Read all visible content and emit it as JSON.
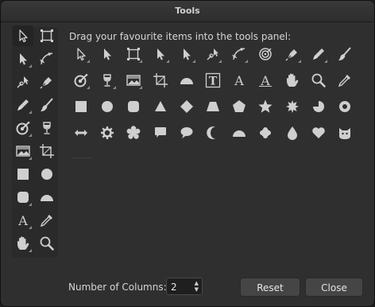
{
  "window": {
    "title": "Tools"
  },
  "prompt": "Drag your favourite items into the tools panel:",
  "text_glyph": "A",
  "footer": {
    "columns_label": "Number of Columns:",
    "columns_value": "2",
    "reset_label": "Reset",
    "close_label": "Close"
  },
  "toolbar_icons": [
    "move-tool-icon",
    "crop-tool-icon",
    "node-tool-icon",
    "corner-tool-icon",
    "point-transform-tool-icon",
    "pen-tool-icon",
    "pencil-tool-icon",
    "vector-brush-tool-icon",
    "fill-tool-icon",
    "transparency-tool-icon",
    "place-image-tool-icon",
    "vector-crop-tool-icon",
    "rectangle-tool-icon",
    "ellipse-tool-icon",
    "rounded-rectangle-tool-icon",
    "segment-tool-icon",
    "artistic-text-tool-icon",
    "color-picker-tool-icon",
    "view-tool-icon",
    "zoom-tool-icon"
  ],
  "palette_icons": [
    "move-tool-icon",
    "node-tool-icon",
    "crop-tool-icon",
    "node-tool-icon",
    "node-tool-icon",
    "point-transform-tool-icon",
    "corner-tool-icon",
    "contour-tool-icon",
    "pen-tool-icon",
    "pencil-tool-icon",
    "vector-brush-tool-icon",
    "fill-tool-icon",
    "transparency-tool-icon",
    "place-image-tool-icon",
    "vector-crop-tool-icon",
    "segment-tool-icon",
    "frame-text-tool-icon",
    "artistic-text-tool-icon",
    "table-text-tool-icon",
    "view-tool-icon",
    "zoom-tool-icon",
    "color-picker-tool-icon",
    "rectangle-tool-icon",
    "ellipse-tool-icon",
    "rounded-rectangle-tool-icon",
    "triangle-tool-icon",
    "diamond-tool-icon",
    "trapezoid-tool-icon",
    "polygon-tool-icon",
    "star-tool-icon",
    "burst-tool-icon",
    "pie-tool-icon",
    "donut-tool-icon",
    "double-arrow-tool-icon",
    "cog-tool-icon",
    "flower-tool-icon",
    "square-callout-tool-icon",
    "ellipse-callout-tool-icon",
    "crescent-tool-icon",
    "segment-tool-icon",
    "cloud-tool-icon",
    "tear-tool-icon",
    "heart-tool-icon",
    "cat-tool-icon"
  ]
}
